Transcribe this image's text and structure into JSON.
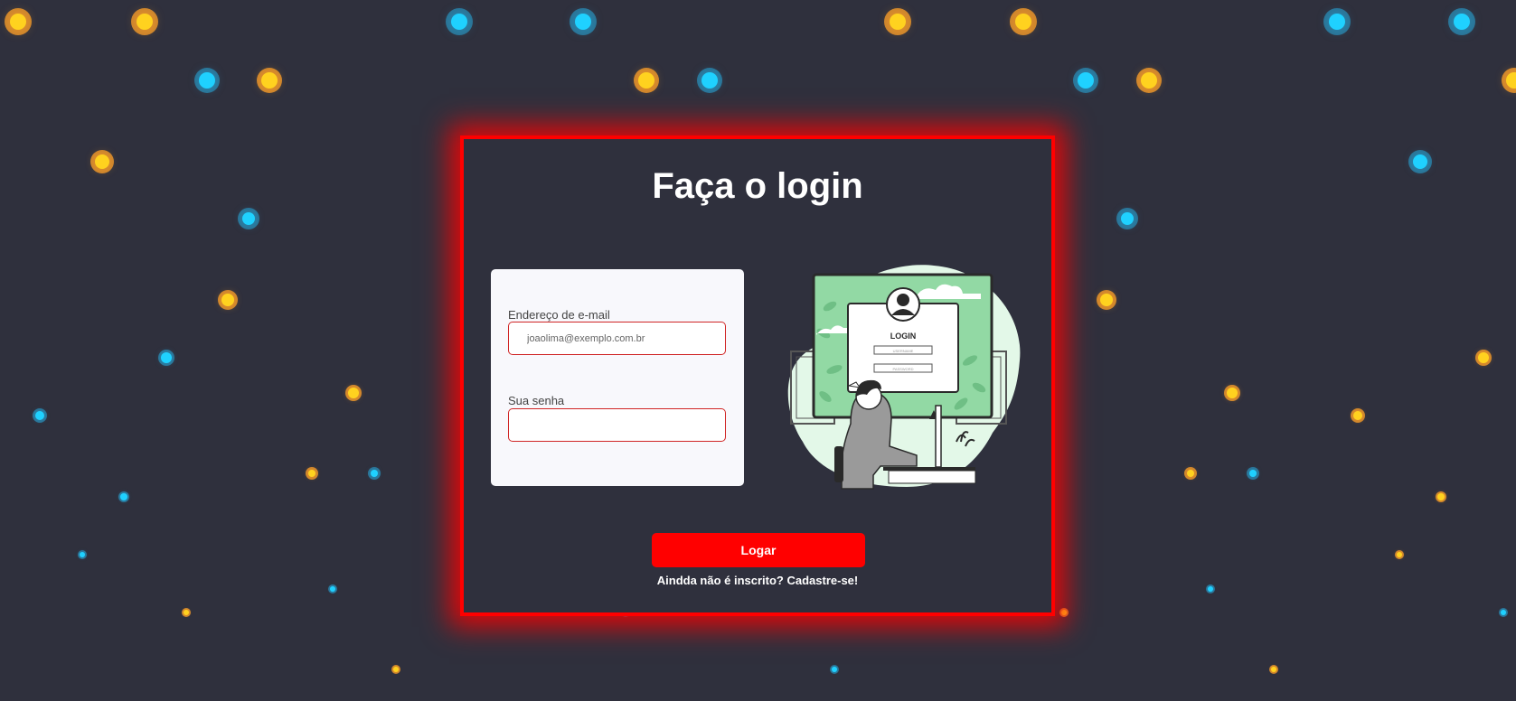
{
  "page": {
    "title": "Faça o login"
  },
  "form": {
    "email_label": "Endereço de e-mail",
    "email_placeholder": "joaolima@exemplo.com.br",
    "email_value": "",
    "password_label": "Sua senha",
    "password_placeholder": "",
    "password_value": ""
  },
  "illustration": {
    "heading": "LOGIN",
    "username_hint": "USERNAME",
    "password_hint": "PASSWORD"
  },
  "actions": {
    "login_label": "Logar",
    "signup_text": "Aindda não é inscrito? Cadastre-se!"
  },
  "colors": {
    "background": "#2f303d",
    "accent": "#ff0000",
    "light_orange": "#ffd21f",
    "light_blue": "#1fd1ff"
  }
}
